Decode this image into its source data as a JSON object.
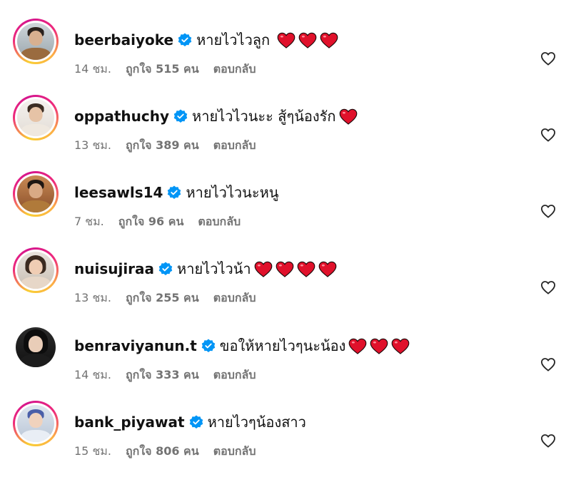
{
  "comments": [
    {
      "username": "beerbaiyoke",
      "text": "หายไวไวลูก",
      "hearts": 3,
      "time": "14 ชม.",
      "likes": "ถูกใจ 515 คน",
      "reply": "ตอบกลับ",
      "ring": true
    },
    {
      "username": "oppathuchy",
      "text": "หายไวไวนะะ สู้ๆน้องรัก",
      "hearts": 1,
      "time": "13 ชม.",
      "likes": "ถูกใจ 389 คน",
      "reply": "ตอบกลับ",
      "ring": true
    },
    {
      "username": "leesawls14",
      "text": "หายไวไวนะหนู",
      "hearts": 0,
      "time": "7 ชม.",
      "likes": "ถูกใจ 96 คน",
      "reply": "ตอบกลับ",
      "ring": true
    },
    {
      "username": "nuisujiraa",
      "text": "หายไวไวน้า",
      "hearts": 4,
      "time": "13 ชม.",
      "likes": "ถูกใจ 255 คน",
      "reply": "ตอบกลับ",
      "ring": true
    },
    {
      "username": "benraviyanun.t",
      "text": "ขอให้หายไวๆนะน้อง",
      "hearts": 3,
      "time": "14 ชม.",
      "likes": "ถูกใจ 333 คน",
      "reply": "ตอบกลับ",
      "ring": false
    },
    {
      "username": "bank_piyawat",
      "text": "หายไวๆน้องสาว",
      "hearts": 0,
      "time": "15 ชม.",
      "likes": "ถูกใจ 806 คน",
      "reply": "ตอบกลับ",
      "ring": true
    }
  ],
  "icons": {
    "verified": "verified-badge-icon",
    "heart": "red-heart-emoji",
    "like": "heart-outline-icon"
  },
  "colors": {
    "verified": "#0095f6",
    "heart": "#e0112b",
    "meta": "#737373",
    "ring_start": "#f9ce34",
    "ring_mid": "#ee2a7b"
  }
}
